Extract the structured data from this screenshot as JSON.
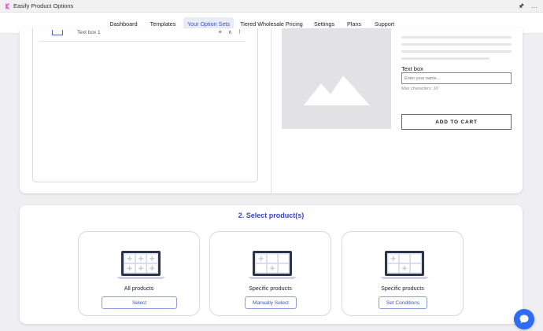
{
  "app": {
    "title": "Easify Product Options",
    "logo_color": "#d64bc4"
  },
  "topbar_icons": [
    "pin-icon",
    "more-icon"
  ],
  "nav": {
    "tabs": [
      {
        "label": "Dashboard",
        "active": false
      },
      {
        "label": "Templates",
        "active": false
      },
      {
        "label": "Your Option Sets",
        "active": true
      },
      {
        "label": "Tiered Wholesale Pricing",
        "active": false
      },
      {
        "label": "Settings",
        "active": false
      },
      {
        "label": "Plans",
        "active": false
      },
      {
        "label": "Support",
        "active": false
      }
    ]
  },
  "options_panel": {
    "rows": [
      {
        "label": "Text box 1",
        "icon": "textbox-icon"
      }
    ]
  },
  "preview": {
    "image_icon": "image-placeholder-icon",
    "textbox_label": "Text box",
    "textbox_placeholder": "Enter your name...",
    "textbox_hint": "Max characters: 10",
    "add_to_cart_label": "ADD TO CART"
  },
  "select_products": {
    "title": "2. Select product(s)",
    "cards": [
      {
        "label": "All products",
        "button": "Select"
      },
      {
        "label": "Specific products",
        "button": "Manually Select"
      },
      {
        "label": "Specific products",
        "button": "Set Conditions"
      }
    ]
  },
  "colors": {
    "accent": "#3b54c5",
    "title_blue": "#3b45b7",
    "chat_bubble": "#2f6cf5"
  }
}
